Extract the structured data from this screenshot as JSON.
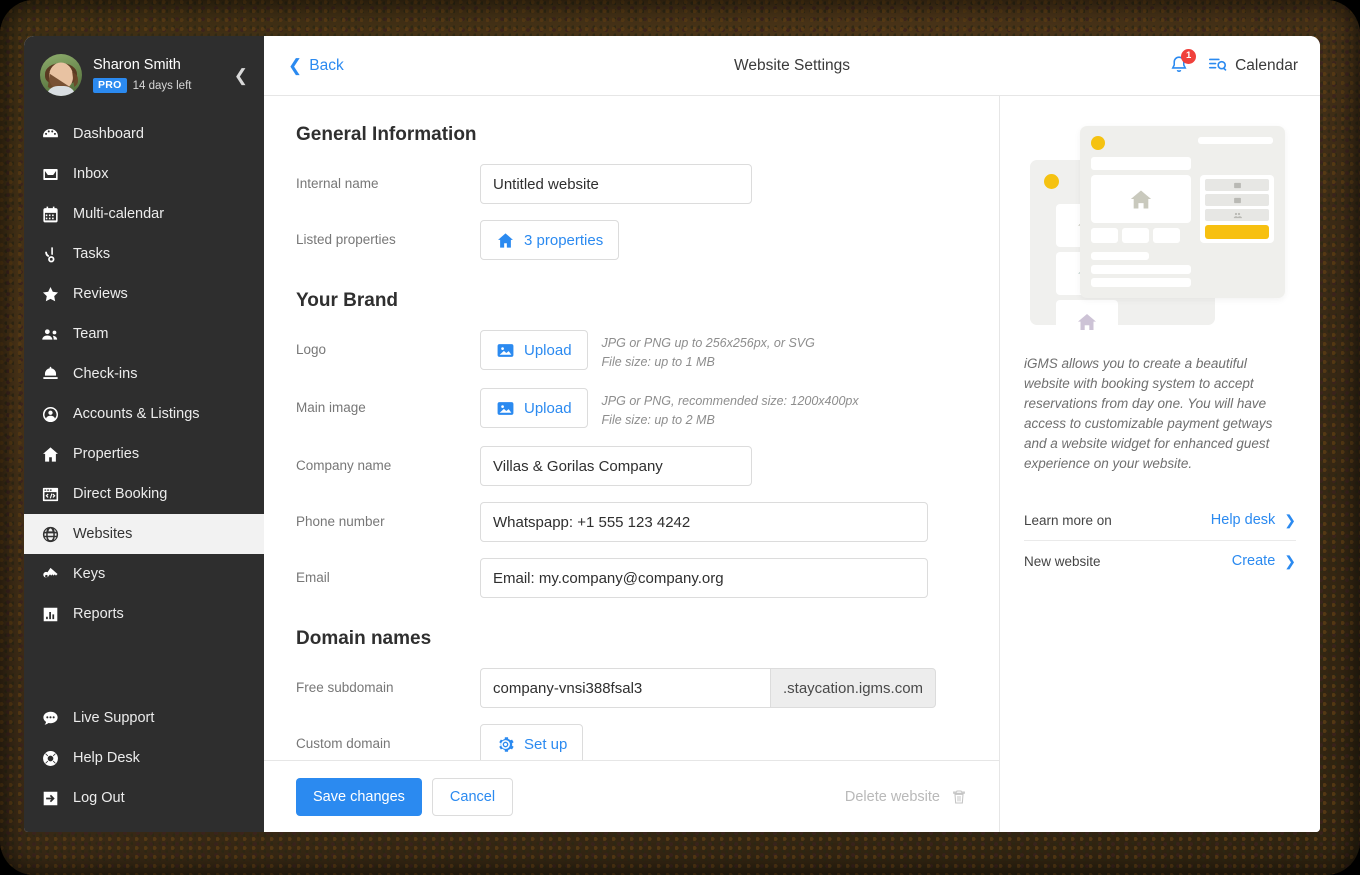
{
  "sidebar": {
    "profile": {
      "name": "Sharon Smith",
      "plan_badge": "PRO",
      "trial": "14 days left",
      "avatar_icon": "user-avatar",
      "collapse_icon": "chevron-left-icon"
    },
    "items": [
      {
        "label": "Dashboard",
        "icon": "dashboard-icon",
        "active": false
      },
      {
        "label": "Inbox",
        "icon": "inbox-icon",
        "active": false
      },
      {
        "label": "Multi-calendar",
        "icon": "calendar-grid-icon",
        "active": false
      },
      {
        "label": "Tasks",
        "icon": "tasks-icon",
        "active": false
      },
      {
        "label": "Reviews",
        "icon": "star-icon",
        "active": false
      },
      {
        "label": "Team",
        "icon": "people-icon",
        "active": false
      },
      {
        "label": "Check-ins",
        "icon": "bell-desk-icon",
        "active": false
      },
      {
        "label": "Accounts & Listings",
        "icon": "account-circle-icon",
        "active": false
      },
      {
        "label": "Properties",
        "icon": "home-icon",
        "active": false
      },
      {
        "label": "Direct Booking",
        "icon": "code-window-icon",
        "active": false
      },
      {
        "label": "Websites",
        "icon": "globe-icon",
        "active": true
      },
      {
        "label": "Keys",
        "icon": "key-icon",
        "active": false
      },
      {
        "label": "Reports",
        "icon": "bar-chart-icon",
        "active": false
      }
    ],
    "bottom_items": [
      {
        "label": "Live Support",
        "icon": "chat-bubble-icon"
      },
      {
        "label": "Help Desk",
        "icon": "lifebuoy-icon"
      },
      {
        "label": "Log Out",
        "icon": "logout-arrow-icon"
      }
    ]
  },
  "topbar": {
    "back_label": "Back",
    "back_icon": "chevron-left-icon",
    "title": "Website Settings",
    "bell_icon": "notification-bell-icon",
    "bell_count": "1",
    "calendar_icon": "calendar-search-icon",
    "calendar_label": "Calendar"
  },
  "form": {
    "general": {
      "heading": "General Information",
      "internal_name": {
        "label": "Internal name",
        "value": "Untitled website",
        "placeholder": "Internal name"
      },
      "listed_properties": {
        "label": "Listed properties",
        "button_label": "3 properties",
        "button_icon": "home-icon"
      }
    },
    "brand": {
      "heading": "Your Brand",
      "logo": {
        "label": "Logo",
        "button_label": "Upload",
        "button_icon": "image-upload-icon",
        "hint_line1": "JPG or PNG up to 256x256px, or SVG",
        "hint_line2": "File size: up to 1 MB"
      },
      "main_image": {
        "label": "Main image",
        "button_label": "Upload",
        "button_icon": "image-upload-icon",
        "hint_line1": "JPG or PNG, recommended size: 1200x400px",
        "hint_line2": "File size: up to 2 MB"
      },
      "company_name": {
        "label": "Company name",
        "value": "Villas & Gorilas Company",
        "placeholder": "Company name"
      },
      "phone_number": {
        "label": "Phone number",
        "value": "Whatspapp: +1 555 123 4242",
        "placeholder": "Phone number"
      },
      "email": {
        "label": "Email",
        "value": "Email: my.company@company.org",
        "placeholder": "Email"
      }
    },
    "domains": {
      "heading": "Domain names",
      "free_subdomain": {
        "label": "Free subdomain",
        "value": "company-vnsi388fsal3",
        "placeholder": "subdomain",
        "suffix": ".staycation.igms.com"
      },
      "custom_domain": {
        "label": "Custom domain",
        "button_label": "Set up",
        "button_icon": "gear-icon"
      }
    },
    "footer": {
      "save_label": "Save changes",
      "cancel_label": "Cancel",
      "delete_label": "Delete website",
      "delete_icon": "trash-icon"
    }
  },
  "info_panel": {
    "illustration_icon": "website-mockup-illustration",
    "description": "iGMS allows you to create a beautiful website with booking system to accept reservations from day one. You will have access to customizable payment getways and a website widget for enhanced guest experience on your website.",
    "rows": [
      {
        "label": "Learn more on",
        "action": "Help desk",
        "chevron": "chevron-right-icon"
      },
      {
        "label": "New website",
        "action": "Create",
        "chevron": "chevron-right-icon"
      }
    ]
  },
  "colors": {
    "accent": "#2b8af0",
    "sidebar_bg": "#2e2e2e",
    "badge_red": "#f0413c",
    "illustration_yellow": "#f5c211",
    "muted_text": "#8d8d8d"
  }
}
